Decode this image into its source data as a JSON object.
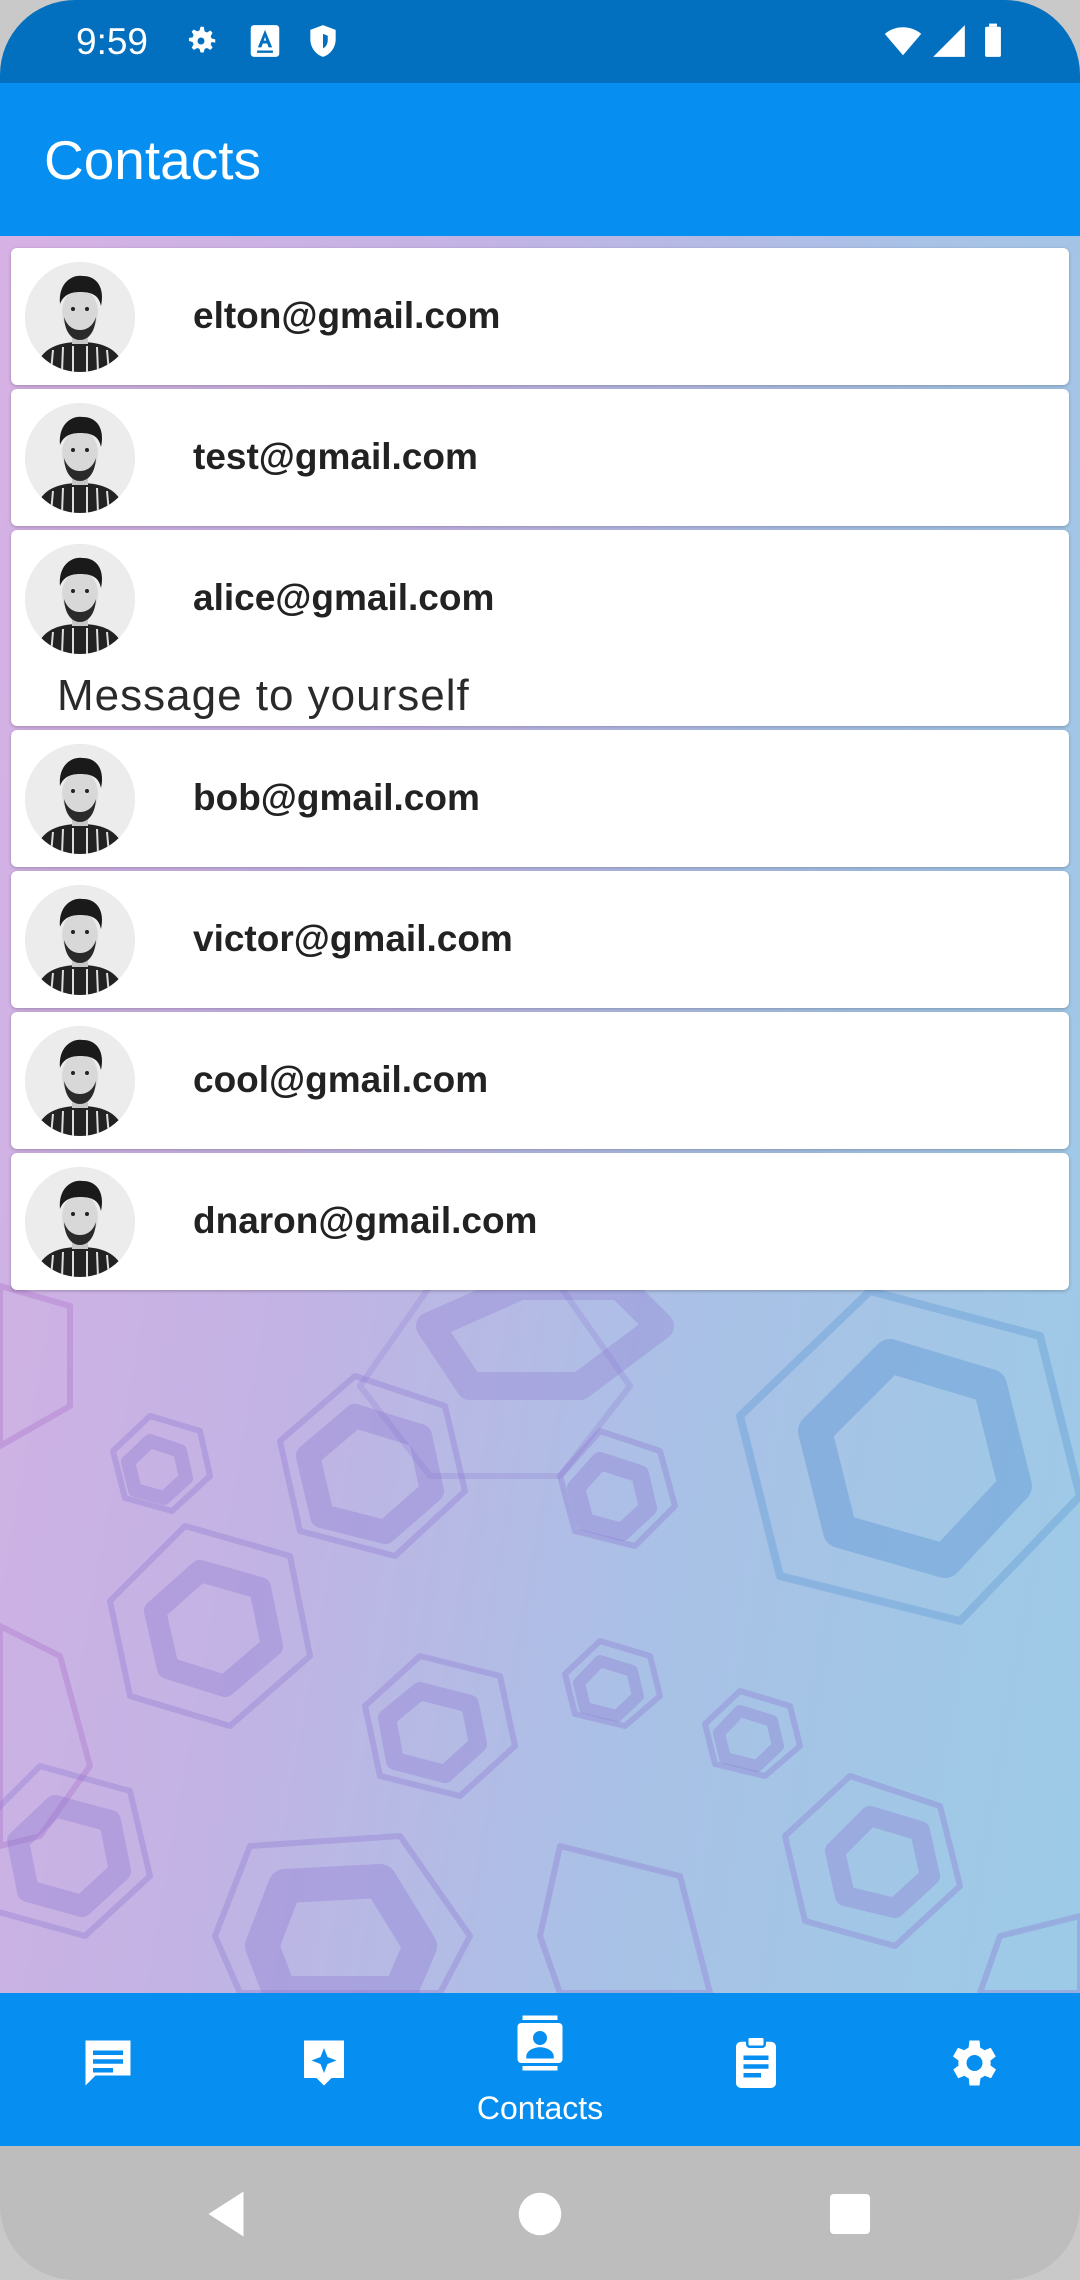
{
  "status_bar": {
    "time": "9:59",
    "icons_left": [
      "gear-icon",
      "font-a-icon",
      "shield-icon"
    ],
    "icons_right": [
      "wifi-icon",
      "signal-icon",
      "battery-icon"
    ]
  },
  "app_bar": {
    "title": "Contacts"
  },
  "contacts": [
    {
      "email": "elton@gmail.com"
    },
    {
      "email": "test@gmail.com"
    },
    {
      "email": "alice@gmail.com",
      "subtitle": "Message to yourself"
    },
    {
      "email": "bob@gmail.com"
    },
    {
      "email": "victor@gmail.com"
    },
    {
      "email": "cool@gmail.com"
    },
    {
      "email": "dnaron@gmail.com"
    }
  ],
  "bottom_nav": {
    "items": [
      {
        "icon": "chat-icon",
        "label": ""
      },
      {
        "icon": "sparkle-message-icon",
        "label": ""
      },
      {
        "icon": "contact-icon",
        "label": "Contacts",
        "active": true
      },
      {
        "icon": "clipboard-icon",
        "label": ""
      },
      {
        "icon": "settings-icon",
        "label": ""
      }
    ]
  },
  "colors": {
    "status_bar": "#0270bf",
    "app_bar": "#068ff1",
    "nav_bar": "#068ff1",
    "card": "#ffffff"
  }
}
